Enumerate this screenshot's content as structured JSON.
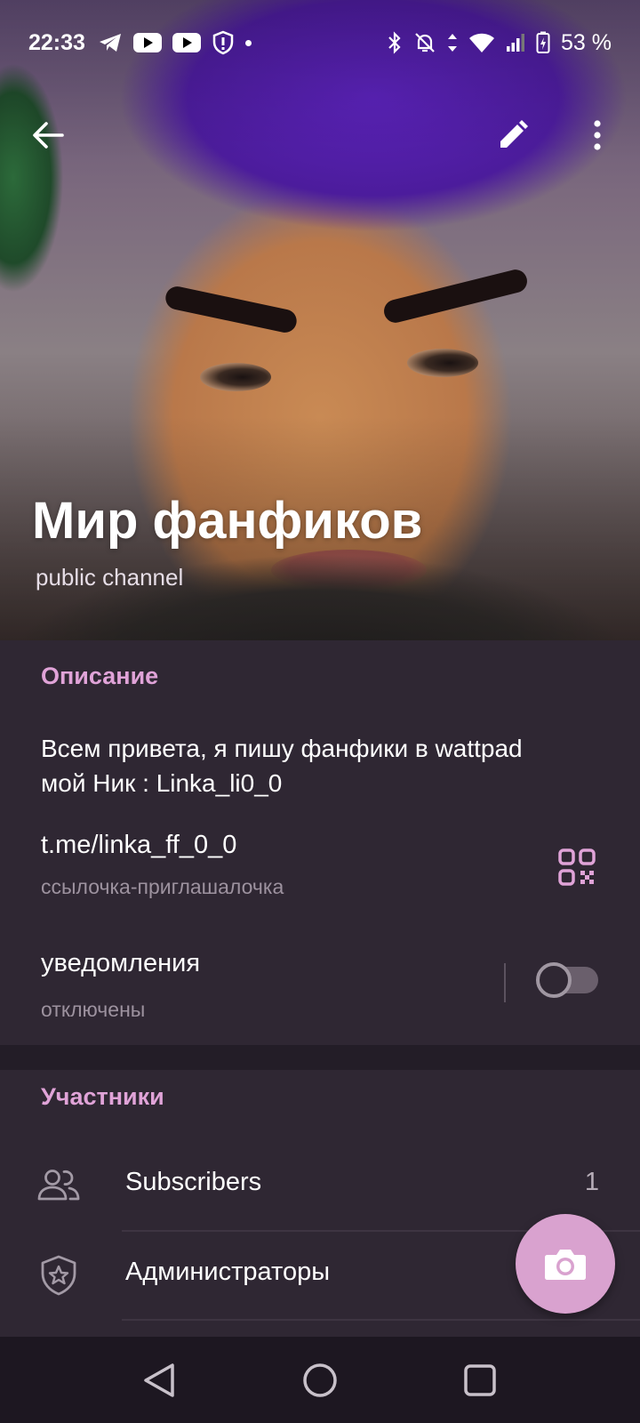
{
  "status_bar": {
    "time": "22:33",
    "battery": "53 %"
  },
  "channel": {
    "title": "Мир фанфиков",
    "subtitle": "public channel"
  },
  "info": {
    "section_title": "Описание",
    "description": "Всем привета, я пишу фанфики в wattpad\nмой Ник : Linka_li0_0",
    "link": "t.me/linka_ff_0_0",
    "link_caption": "ссылочка-приглашалочка",
    "notifications_label": "уведомления",
    "notifications_state": "отключены",
    "notifications_enabled": false
  },
  "members": {
    "section_title": "Участники",
    "rows": [
      {
        "label": "Subscribers",
        "count": "1",
        "icon": "users-icon"
      },
      {
        "label": "Администраторы",
        "count": "",
        "icon": "shield-star-icon"
      }
    ]
  },
  "colors": {
    "accent": "#e0a3d8",
    "fab": "#d9a2cf",
    "card": "#2f2733",
    "background": "#231d27"
  }
}
